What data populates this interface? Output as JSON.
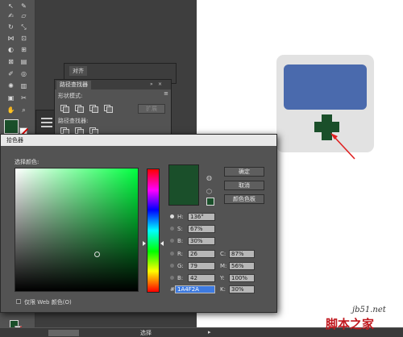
{
  "panels": {
    "back_tab": "对齐",
    "pathfinder_tab": "路径查找器",
    "shape_modes_label": "形状模式:",
    "pathfinders_label": "路径查找器:",
    "expand_label": "扩展"
  },
  "color_picker": {
    "title": "拾色器",
    "choose_label": "选择颜色:",
    "ok_label": "确定",
    "cancel_label": "取消",
    "swatches_label": "颜色色板",
    "new_color": "#1A4F2A",
    "fields": {
      "H": {
        "label": "H:",
        "value": "136°"
      },
      "S": {
        "label": "S:",
        "value": "67%"
      },
      "Bv": {
        "label": "B:",
        "value": "30%"
      },
      "R": {
        "label": "R:",
        "value": "26"
      },
      "G": {
        "label": "G:",
        "value": "79"
      },
      "Bc": {
        "label": "B:",
        "value": "42"
      },
      "C": {
        "label": "C:",
        "value": "87%"
      },
      "M": {
        "label": "M:",
        "value": "56%"
      },
      "Y": {
        "label": "Y:",
        "value": "100%"
      },
      "K": {
        "label": "K:",
        "value": "30%"
      },
      "hex": {
        "label": "#",
        "value": "1A4F2A"
      }
    },
    "web_only_label": "仅限 Web 颜色(O)"
  },
  "statusbar": {
    "select_label": "选择"
  },
  "colors": {
    "icon_blue": "#4a6aad",
    "plus_green": "#1A4F2A",
    "card_grey": "#e2e2e2"
  },
  "watermark": {
    "site": "jb51.net",
    "name": "脚本之家"
  }
}
